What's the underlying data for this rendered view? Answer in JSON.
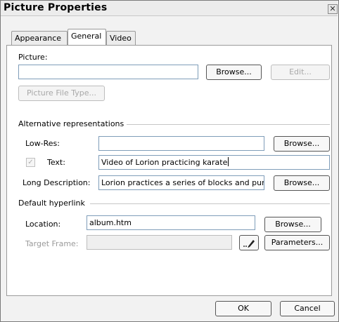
{
  "window": {
    "title": "Picture Properties",
    "close_icon": "✕"
  },
  "tabs": [
    {
      "label": "Appearance",
      "active": false
    },
    {
      "label": "General",
      "active": true
    },
    {
      "label": "Video",
      "active": false
    }
  ],
  "picture": {
    "label": "Picture:",
    "value": "",
    "browse_label": "Browse...",
    "edit_label": "Edit...",
    "file_type_label": "Picture File Type..."
  },
  "alternative": {
    "section_label": "Alternative representations",
    "lowres_label": "Low-Res:",
    "lowres_value": "",
    "lowres_browse": "Browse...",
    "text_label": "Text:",
    "text_checked": true,
    "text_value": "Video of Lorion practicing karate",
    "longdesc_label": "Long Description:",
    "longdesc_value": "Lorion practices a series of blocks and punc",
    "longdesc_browse": "Browse..."
  },
  "hyperlink": {
    "section_label": "Default hyperlink",
    "location_label": "Location:",
    "location_value": "album.htm",
    "location_browse": "Browse...",
    "target_label": "Target Frame:",
    "target_value": "",
    "pencil_icon": "pencil-icon",
    "parameters_label": "Parameters..."
  },
  "footer": {
    "ok_label": "OK",
    "cancel_label": "Cancel"
  }
}
